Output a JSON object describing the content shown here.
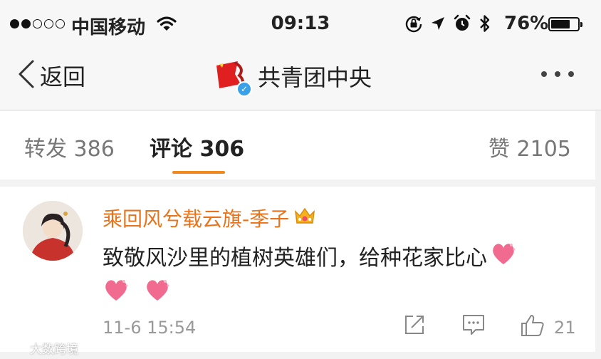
{
  "status_bar": {
    "carrier": "中国移动",
    "time": "09:13",
    "battery_percent": "76%",
    "battery_level": 0.76,
    "signal_full_dots": 2,
    "signal_total_dots": 5
  },
  "nav": {
    "back_label": "返回",
    "title": "共青团中央"
  },
  "tabs": [
    {
      "label": "转发",
      "count": "386"
    },
    {
      "label": "评论",
      "count": "306"
    },
    {
      "label": "赞",
      "count": "2105"
    }
  ],
  "comment": {
    "username": "乘回风兮载云旗-季子",
    "text": "致敬风沙里的植树英雄们，给种花家比心",
    "time": "11-6 15:54",
    "likes": "21"
  },
  "watermark": "大数跨境",
  "colors": {
    "accent": "#f08a1d",
    "username": "#e8731a",
    "verified": "#3aa0e8"
  }
}
